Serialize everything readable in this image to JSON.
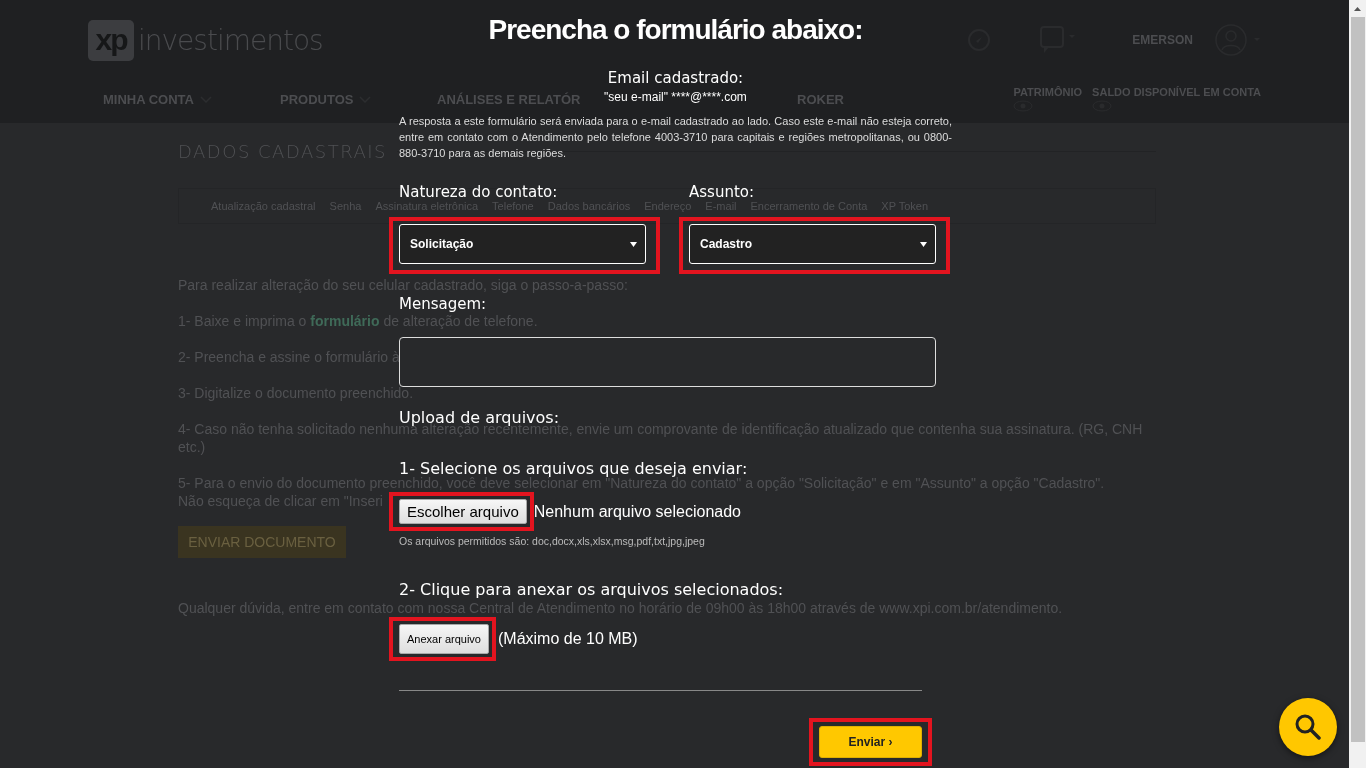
{
  "background_page": {
    "logo": {
      "mark": "xp",
      "wordmark": "investimentos"
    },
    "nav": [
      {
        "label": "MINHA CONTA",
        "dropdown": true
      },
      {
        "label": "PRODUTOS",
        "dropdown": true
      },
      {
        "label": "ANÁLISES E RELATÓR",
        "dropdown": false
      },
      {
        "label": "ROKER",
        "dropdown": false
      }
    ],
    "user": {
      "name": "EMERSON"
    },
    "balances": [
      "PATRIMÔNIO",
      "SALDO DISPONÍVEL EM CONTA"
    ],
    "section_title": "DADOS CADASTRAIS",
    "tabs": [
      "Atualização cadastral",
      "Senha",
      "Assinatura eletrônica",
      "Telefone",
      "Dados bancários",
      "Endereço",
      "E-mail",
      "Encerramento de Conta",
      "XP Token"
    ],
    "instructions": [
      "Para realizar alteração do seu celular cadastrado, siga o passo-a-passo:",
      "1- Baixe e imprima o **formulário** de alteração de telefone.",
      "2- Preencha e assine o formulário à",
      "3- Digitalize o documento preenchido.",
      "4- Caso não tenha solicitado nenhuma alteração recentemente, envie um comprovante de identificação atualizado que contenha sua assinatura. (RG, CNH etc.)",
      "5- Para o envio do documento preenchido, você deve selecionar em \"Natureza do contato\" a opção \"Solicitação\" e em \"Assunto\" a opção \"Cadastro\".",
      "Não esqueça de clicar em \"Inseri"
    ],
    "button": "ENVIAR DOCUMENTO",
    "footer_note": "Qualquer dúvida, entre em contato com nossa Central de Atendimento no horário de 09h00 às 18h00 através de www.xpi.com.br/atendimento."
  },
  "modal": {
    "title": "Preencha o formulário abaixo:",
    "email_label": "Email cadastrado:",
    "email_value": "\"seu e-mail\" ****@****.com",
    "notice": "A resposta a este formulário será enviada para o e-mail cadastrado ao lado. Caso este e-mail não esteja correto, entre em contato com o Atendimento pelo telefone 4003-3710 para capitais e regiões metropolitanas, ou 0800-880-3710 para as demais regiões.",
    "selects": [
      {
        "label": "Natureza do contato:",
        "value": "Solicitação",
        "highlighted": true
      },
      {
        "label": "Assunto:",
        "value": "Cadastro",
        "highlighted": true
      }
    ],
    "message_label": "Mensagem:",
    "upload_title": "Upload de arquivos:",
    "step1": "1- Selecione os arquivos que deseja enviar:",
    "choose_button": "Escolher arquivo",
    "choose_highlighted": true,
    "no_file": "Nenhum arquivo selecionado",
    "allowed": "Os arquivos permitidos são: doc,docx,xls,xlsx,msg,pdf,txt,jpg,jpeg",
    "step2": "2- Clique para anexar os arquivos selecionados:",
    "attach_button": "Anexar arquivo",
    "attach_highlighted": true,
    "max_size": "(Máximo de 10 MB)",
    "submit": "Enviar ›",
    "submit_highlighted": true
  }
}
